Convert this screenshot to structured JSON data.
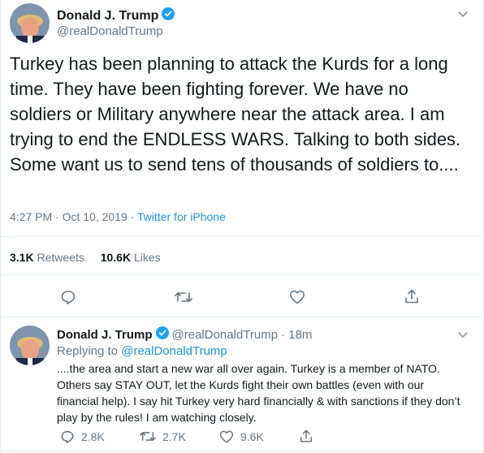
{
  "main_tweet": {
    "author_name": "Donald J. Trump",
    "handle": "@realDonaldTrump",
    "text": "Turkey has been planning to attack the Kurds for a long time. They have been fighting forever. We have no soldiers or Military anywhere near the attack area. I am trying to end the ENDLESS WARS. Talking to both sides. Some want us to send tens of thousands of soldiers to....",
    "timestamp": "4:27 PM · Oct 10, 2019 · ",
    "source": "Twitter for iPhone",
    "retweets_count": "3.1K",
    "retweets_label": "Retweets",
    "likes_count": "10.6K",
    "likes_label": "Likes"
  },
  "reply_tweet": {
    "author_name": "Donald J. Trump",
    "handle": "@realDonaldTrump",
    "age": "· 18m",
    "replying_prefix": "Replying to ",
    "replying_handle": "@realDonaldTrump",
    "text": "....the area and start a new war all over again. Turkey is a member of NATO. Others say STAY OUT, let the Kurds fight their own battles (even with our financial help). I say hit Turkey very hard financially & with sanctions if they don’t play by the rules! I am watching closely.",
    "replies_count": "2.8K",
    "retweets_count": "2.7K",
    "likes_count": "9.6K"
  },
  "colors": {
    "accent": "#1b95e0",
    "verified": "#1da1f2",
    "muted": "#657786",
    "text": "#14171a",
    "divider": "#e6ecf0"
  },
  "icons": [
    "chevron-down-icon",
    "verified-badge-icon",
    "reply-icon",
    "retweet-icon",
    "like-icon",
    "share-icon"
  ]
}
